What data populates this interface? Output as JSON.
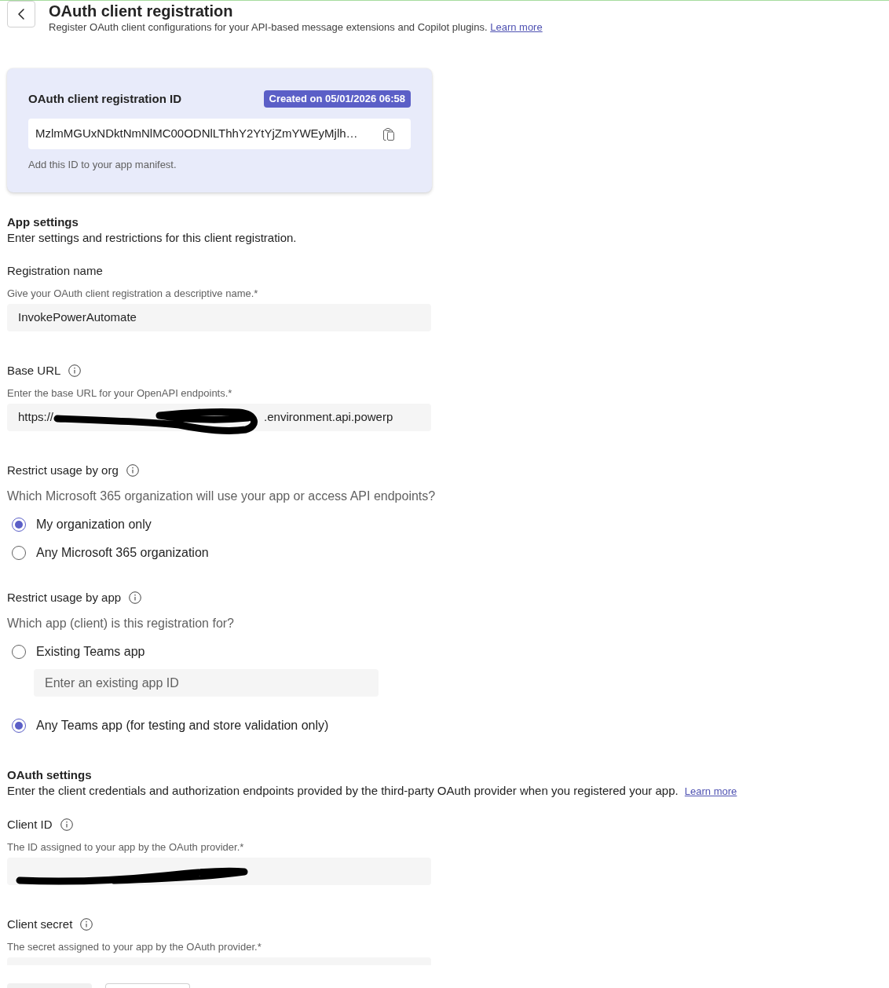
{
  "header": {
    "title": "OAuth client registration",
    "subtitle": "Register OAuth client configurations for your API-based message extensions and Copilot plugins.",
    "link": "Learn more"
  },
  "registration_card": {
    "title": "OAuth client registration ID",
    "badge": "Created on 05/01/2026 06:58",
    "id_value": "MzlmMGUxNDktNmNlMC00ODNlLThhY2YtYjZmYWEyMjlh…",
    "hint": "Add this ID to your app manifest."
  },
  "app_settings": {
    "title": "App settings",
    "description": "Enter settings and restrictions for this client registration.",
    "items": [
      {
        "kind": "field",
        "label": "Registration name",
        "info": false,
        "hint": "Give your OAuth client registration a descriptive name.*",
        "value_segments": [
          {
            "kind": "text",
            "text": "InvokePowerAutomate"
          }
        ]
      },
      {
        "kind": "field",
        "label": "Base URL",
        "info": true,
        "hint": "Enter the base URL for your OpenAPI endpoints.*",
        "value_segments": [
          {
            "kind": "text",
            "text": "https://"
          },
          {
            "kind": "redaction"
          },
          {
            "kind": "text",
            "text": ".environment.api.powerp"
          }
        ]
      },
      {
        "kind": "choice",
        "label": "Restrict usage by org",
        "info": true,
        "question": "Which Microsoft 365 organization will use your app or access API endpoints?",
        "options": [
          {
            "label": "My organization only",
            "selected": true
          },
          {
            "label": "Any Microsoft 365 organization",
            "selected": false
          }
        ]
      },
      {
        "kind": "choice",
        "label": "Restrict usage by app",
        "info": true,
        "question": "Which app (client) is this registration for?",
        "options": [
          {
            "label": "Existing Teams app",
            "selected": false,
            "input": {
              "placeholder": "Enter an existing app ID"
            }
          },
          {
            "label": "Any Teams app (for testing and store validation only)",
            "selected": true
          }
        ]
      }
    ]
  },
  "oauth_settings": {
    "title": "OAuth settings",
    "description": "Enter the client credentials and authorization endpoints provided by the third-party OAuth provider when you registered your app.",
    "link": "Learn more",
    "items": [
      {
        "kind": "field",
        "label": "Client ID",
        "info": true,
        "hint": "The ID assigned to your app by the OAuth provider.*",
        "value_segments": [
          {
            "kind": "redaction"
          }
        ]
      },
      {
        "kind": "field",
        "label": "Client secret",
        "info": true,
        "hint": "The secret assigned to your app by the OAuth provider.*"
      }
    ]
  },
  "footer_buttons": [
    {
      "kind": "filled"
    },
    {
      "kind": "outline"
    }
  ]
}
